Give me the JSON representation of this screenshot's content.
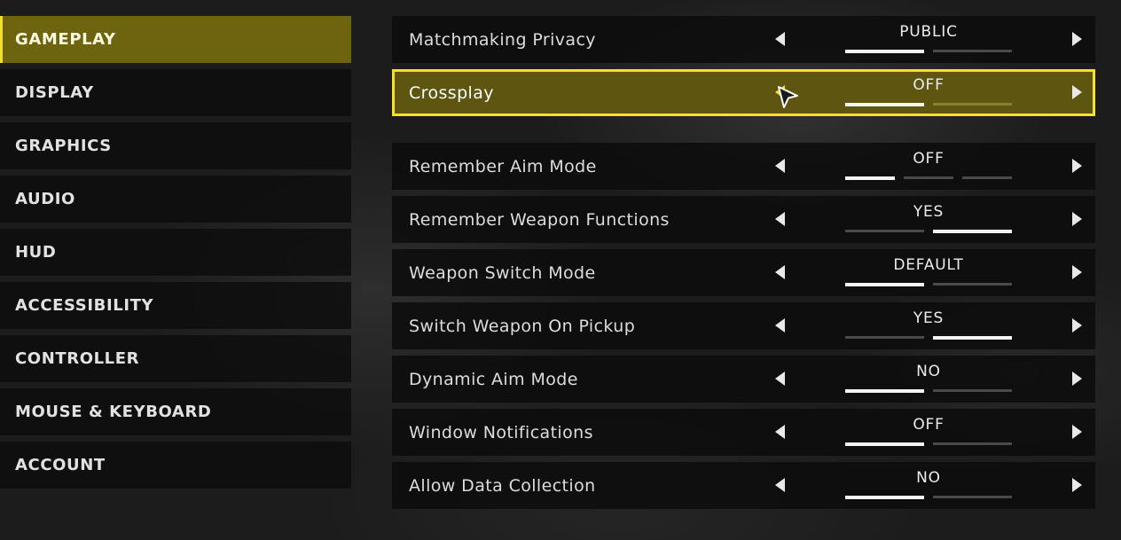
{
  "sidebar": {
    "items": [
      {
        "label": "GAMEPLAY",
        "active": true
      },
      {
        "label": "DISPLAY"
      },
      {
        "label": "GRAPHICS"
      },
      {
        "label": "AUDIO"
      },
      {
        "label": "HUD"
      },
      {
        "label": "ACCESSIBILITY"
      },
      {
        "label": "CONTROLLER"
      },
      {
        "label": "MOUSE & KEYBOARD"
      },
      {
        "label": "ACCOUNT"
      }
    ]
  },
  "settings": {
    "rows": [
      {
        "name": "Matchmaking Privacy",
        "value": "PUBLIC",
        "option_count": 2,
        "selected_index": 0
      },
      {
        "name": "Crossplay",
        "value": "OFF",
        "option_count": 2,
        "selected_index": 0,
        "focused": true
      },
      {
        "name": "Remember Aim Mode",
        "value": "OFF",
        "option_count": 3,
        "selected_index": 0
      },
      {
        "name": "Remember Weapon Functions",
        "value": "YES",
        "option_count": 2,
        "selected_index": 1
      },
      {
        "name": "Weapon Switch Mode",
        "value": "DEFAULT",
        "option_count": 2,
        "selected_index": 0
      },
      {
        "name": "Switch Weapon On Pickup",
        "value": "YES",
        "option_count": 2,
        "selected_index": 1
      },
      {
        "name": "Dynamic Aim Mode",
        "value": "NO",
        "option_count": 2,
        "selected_index": 0
      },
      {
        "name": "Window Notifications",
        "value": "OFF",
        "option_count": 2,
        "selected_index": 0
      },
      {
        "name": "Allow Data Collection",
        "value": "NO",
        "option_count": 2,
        "selected_index": 0
      }
    ]
  },
  "colors": {
    "accent": "#f4e128",
    "active_fill": "#6e6410",
    "row_bg": "#0c0c0c",
    "text": "#dcdcdc"
  },
  "icons": {
    "prev": "arrow-left-icon",
    "next": "arrow-right-icon",
    "pointer": "mouse-pointer-icon"
  }
}
